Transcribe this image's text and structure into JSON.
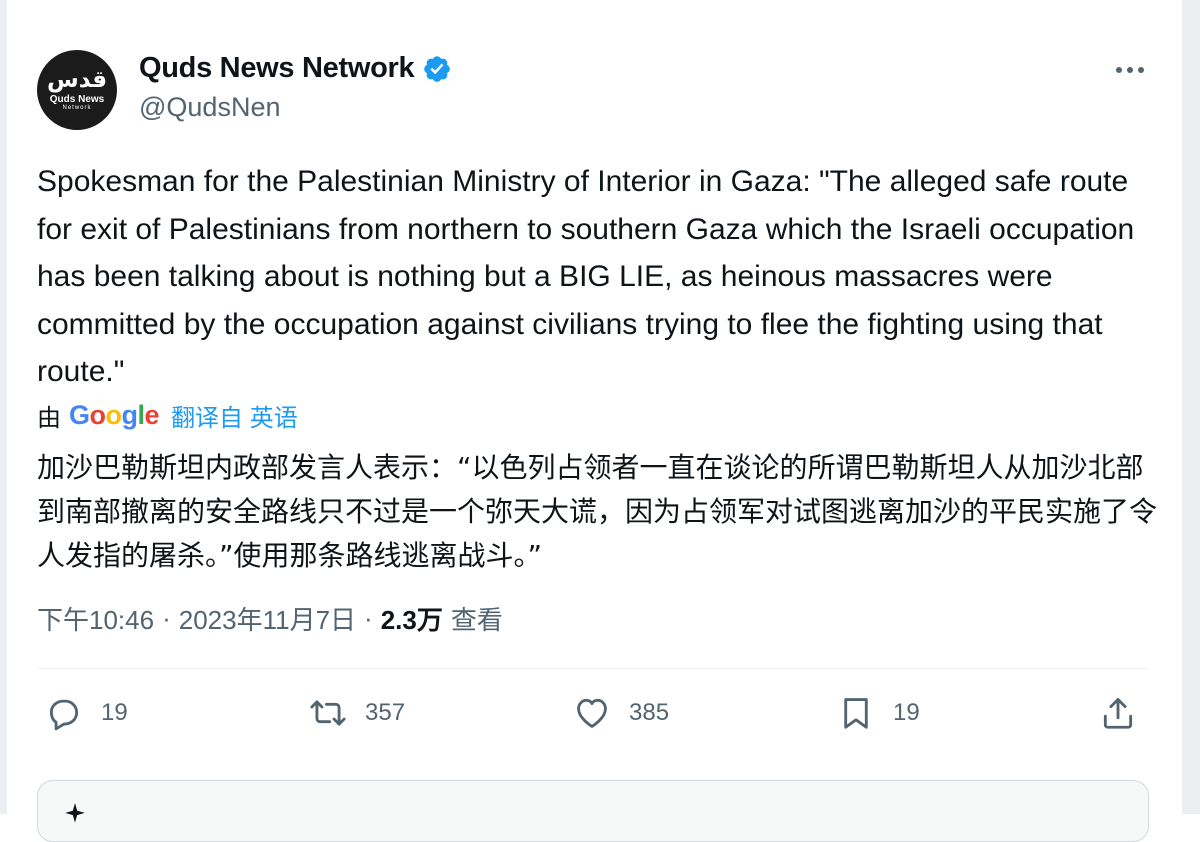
{
  "author": {
    "display_name": "Quds News Network",
    "handle": "@QudsNen",
    "verified": true,
    "avatar_logo_glyph": "قدس",
    "avatar_logo_name": "Quds News",
    "avatar_logo_sub": "Network"
  },
  "tweet": {
    "text": "Spokesman for the Palestinian Ministry of Interior in Gaza: \"The alleged safe route for exit of Palestinians from northern to southern Gaza which the Israeli occupation has been talking about is nothing but a BIG LIE, as heinous massacres were committed by the occupation against civilians trying to flee the fighting using that route.\"",
    "translate_by": "由",
    "translate_provider": "Google",
    "translate_from": "翻译自 英语",
    "translated_text": "加沙巴勒斯坦内政部发言人表示：“以色列占领者一直在谈论的所谓巴勒斯坦人从加沙北部到南部撤离的安全路线只不过是一个弥天大谎，因为占领军对试图逃离加沙的平民实施了令人发指的屠杀。”使用那条路线逃离战斗。”",
    "time": "下午10:46",
    "date": "2023年11月7日",
    "separator": "·",
    "views_count": "2.3万",
    "views_label": "查看"
  },
  "actions": {
    "reply_count": "19",
    "retweet_count": "357",
    "like_count": "385",
    "bookmark_count": "19"
  },
  "icons": {
    "verified": "verified-badge-icon",
    "more": "more-icon",
    "reply": "reply-icon",
    "retweet": "retweet-icon",
    "like": "heart-icon",
    "bookmark": "bookmark-icon",
    "share": "share-icon",
    "sparkle": "sparkle-icon"
  },
  "colors": {
    "accent": "#1d9bf0",
    "text": "#0f1419",
    "secondary": "#536471",
    "google_blue": "#4285F4",
    "google_red": "#EA4335",
    "google_yellow": "#FBBC05",
    "google_green": "#34A853"
  }
}
